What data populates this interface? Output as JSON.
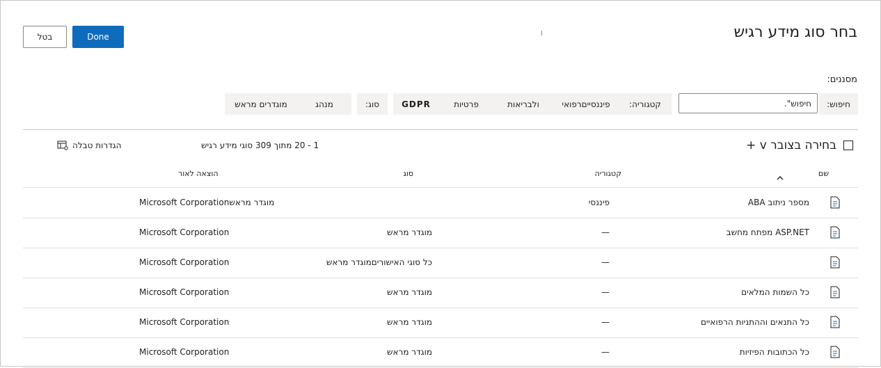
{
  "header": {
    "title": "בחר סוג מידע רגיש",
    "done_label": "Done",
    "cancel_label": "בטל"
  },
  "filters": {
    "label": "מסננים:",
    "search_label": "חיפוש:",
    "search_value": "חיפוש\".",
    "segments": [
      {
        "label": "קטגוריה:",
        "width": 76
      },
      {
        "label": "פיננסייםרפואי",
        "width": 94
      },
      {
        "label": "ולבריאות",
        "width": 86
      },
      {
        "label": "פרטיות",
        "width": 78
      },
      {
        "label": "GDPR",
        "width": 66
      },
      {
        "label": "סוג:",
        "width": 44
      },
      {
        "label": "מנהג",
        "width": 78
      },
      {
        "label": "מוגדרים מראש",
        "width": 104
      }
    ]
  },
  "list": {
    "select_all_label": "בחירה בצובר v +",
    "count_text": "1 - 20 מתוך 309 סוגי מידע רגיש",
    "table_settings_label": "הגדרות טבלה",
    "columns": {
      "name": "שם",
      "category": "קטגוריה",
      "type": "סוג",
      "publisher": "הוצאה לאור"
    },
    "rows": [
      {
        "name": "מספר ניתוב ABA",
        "category": "פיננסי",
        "type": "",
        "publisher": "Microsoft Corporationמוגדר מראש"
      },
      {
        "name": "ASP.NET מפתח מחשב",
        "category": "—",
        "type": "מוגדר מראש",
        "publisher": "Microsoft Corporation"
      },
      {
        "name": "",
        "category": "—",
        "type": "כל סוגי האישוריםמוגדר מראש",
        "publisher": "Microsoft Corporation"
      },
      {
        "name": "כל השמות המלאים",
        "category": "—",
        "type": "מוגדר מראש",
        "publisher": "Microsoft Corporation"
      },
      {
        "name": "כל התנאים וההתניות הרפואיים",
        "category": "—",
        "type": "מוגדר מראש",
        "publisher": "Microsoft Corporation"
      },
      {
        "name": "כל הכתובות הפיזיות",
        "category": "—",
        "type": "מוגדר מראש",
        "publisher": "Microsoft Corporation"
      }
    ]
  },
  "colors": {
    "primary": "#0f6cbd",
    "filter_bg": "#f3f2f1",
    "border": "#c8c6c4"
  }
}
